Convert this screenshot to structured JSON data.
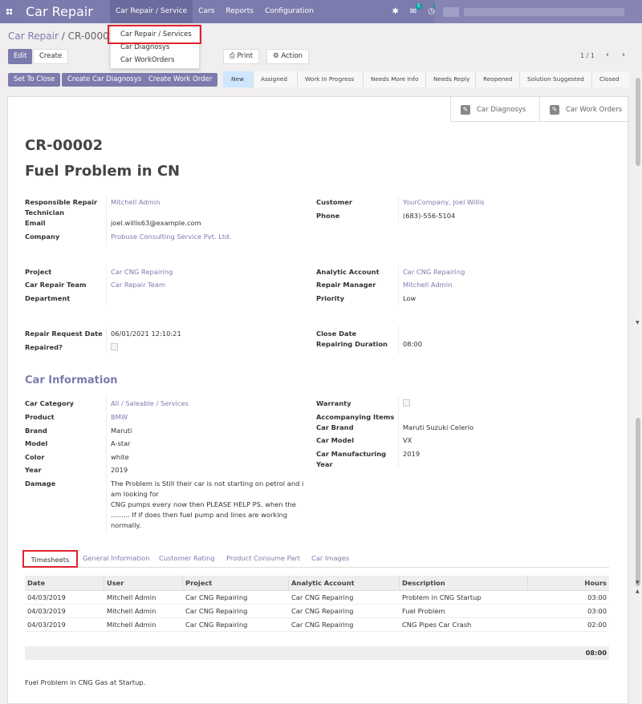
{
  "navbar": {
    "brand": "Car Repair",
    "menu": [
      "Car Repair / Service",
      "Cars",
      "Reports",
      "Configuration"
    ],
    "messages_count": "5",
    "activity_count": "2"
  },
  "dropdown": [
    "Car Repair / Services",
    "Car Diagnosys",
    "Car WorkOrders"
  ],
  "breadcrumb": {
    "parent": "Car Repair",
    "sep": "/",
    "current": "CR-00002"
  },
  "controls": {
    "edit": "Edit",
    "create": "Create",
    "print": "Print",
    "action": "Action",
    "pager": "1 / 1",
    "prev": "‹",
    "next": "›"
  },
  "header_buttons": [
    "Set To Close",
    "Create Car Diagnosys",
    "Create Work Order"
  ],
  "stages": [
    "New",
    "Assigned",
    "Work In Progress",
    "Needs More Info",
    "Needs Reply",
    "Reopened",
    "Solution Suggested",
    "Closed"
  ],
  "active_stage": "New",
  "smart_buttons": [
    "Car Diagnosys",
    "Car Work Orders"
  ],
  "record": {
    "id": "CR-00002",
    "name": "Fuel Problem in CN",
    "responsible_label_1": "Responsible Repair",
    "responsible_label_2": "Technician",
    "responsible": "Mitchell Admin",
    "email_label": "Email",
    "email": "joel.willis63@example.com",
    "company_label": "Company",
    "company": "Probuse Consulting Service Pvt. Ltd.",
    "customer_label": "Customer",
    "customer": "YourCompany, Joel Willis",
    "phone_label": "Phone",
    "phone": "(683)-556-5104",
    "project_label": "Project",
    "project": "Car CNG Repairing",
    "team_label": "Car Repair Team",
    "team": "Car Repair Team",
    "department_label": "Department",
    "analytic_label": "Analytic Account",
    "analytic": "Car CNG Repairing",
    "manager_label": "Repair Manager",
    "manager": "Mitchell Admin",
    "priority_label": "Priority",
    "priority": "Low",
    "request_date_label": "Repair Request Date",
    "request_date": "06/01/2021 12:10:21",
    "repaired_label": "Repaired?",
    "close_date_label": "Close Date",
    "duration_label": "Repairing Duration",
    "duration": "08:00"
  },
  "car_info": {
    "title": "Car Information",
    "category_label": "Car Category",
    "category": "All / Saleable / Services",
    "product_label": "Product",
    "product": "BMW",
    "brand_label": "Brand",
    "brand": "Maruti",
    "model_label": "Model",
    "model": "A-star",
    "color_label": "Color",
    "color": "white",
    "year_label": "Year",
    "year": "2019",
    "damage_label": "Damage",
    "damage_lines": [
      "The Problem is Still their car is not starting on petrol and i",
      "am looking for",
      "CNG pumps every now then PLEASE HELP PS. when the",
      "......... If if does then fuel pump and lines are working",
      "normally."
    ],
    "warranty_label": "Warranty",
    "accompanying_label": "Accompanying Items",
    "car_brand_label": "Car Brand",
    "car_brand": "Maruti Suzuki Celerio",
    "car_model_label": "Car Model",
    "car_model": "VX",
    "mfg_year_label_1": "Car Manufacturing",
    "mfg_year_label_2": "Year",
    "mfg_year": "2019"
  },
  "tabs": [
    "Timesheets",
    "General Information",
    "Customer Rating",
    "Product Consume Part",
    "Car Images"
  ],
  "timesheet": {
    "headers": [
      "Date",
      "User",
      "Project",
      "Analytic Account",
      "Description",
      "Hours"
    ],
    "rows": [
      [
        "04/03/2019",
        "Mitchell Admin",
        "Car CNG Repairing",
        "Car CNG Repairing",
        "Problem in CNG Startup",
        "03:00"
      ],
      [
        "04/03/2019",
        "Mitchell Admin",
        "Car CNG Repairing",
        "Car CNG Repairing",
        "Fuel Problem",
        "03:00"
      ],
      [
        "04/03/2019",
        "Mitchell Admin",
        "Car CNG Repairing",
        "Car CNG Repairing",
        "CNG Pipes Car Crash",
        "02:00"
      ]
    ],
    "total": "08:00"
  },
  "note": "Fuel Problem in CNG Gas at Startup.",
  "colors": {
    "primary": "#7c7bad",
    "highlight": "#e0232d"
  }
}
